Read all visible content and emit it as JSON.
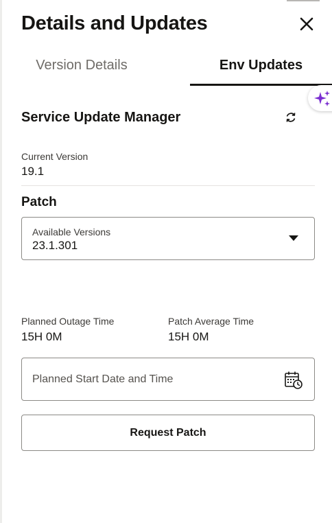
{
  "panel": {
    "title": "Details and Updates",
    "close_icon": "close-icon"
  },
  "tabs": [
    {
      "label": "Version Details",
      "selected": false
    },
    {
      "label": "Env Updates",
      "selected": true
    }
  ],
  "ai_assist": {
    "icon": "sparkle-icon",
    "color": "#7b2fd1"
  },
  "section": {
    "title": "Service Update Manager",
    "refresh_icon": "refresh-icon"
  },
  "current_version": {
    "label": "Current Version",
    "value": "19.1"
  },
  "patch": {
    "title": "Patch",
    "available_versions_label": "Available Versions",
    "available_versions_value": "23.1.301"
  },
  "outage": {
    "planned_label": "Planned Outage Time",
    "planned_value": "15H 0M",
    "average_label": "Patch Average Time",
    "average_value": "15H 0M"
  },
  "start_date": {
    "placeholder": "Planned Start Date and Time",
    "icon": "calendar-clock-icon"
  },
  "request_button": {
    "label": "Request Patch"
  }
}
